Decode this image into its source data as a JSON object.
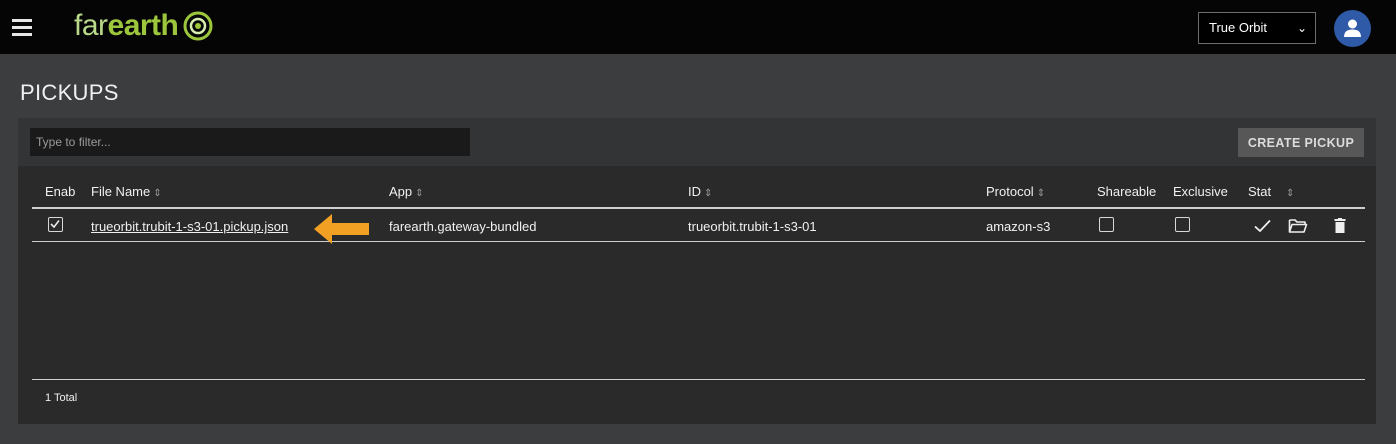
{
  "header": {
    "logo_far": "far",
    "logo_earth": "earth",
    "org_selected": "True Orbit",
    "menu_icon": "hamburger-icon",
    "avatar_icon": "user-icon"
  },
  "page": {
    "title": "PICKUPS"
  },
  "toolbar": {
    "filter_placeholder": "Type to filter...",
    "create_label": "CREATE PICKUP"
  },
  "table": {
    "columns": {
      "enabled": "Enab",
      "file_name": "File Name",
      "app": "App",
      "id": "ID",
      "protocol": "Protocol",
      "shareable": "Shareable",
      "exclusive": "Exclusive",
      "status": "Stat"
    },
    "sort_glyph": "⇕",
    "rows": [
      {
        "enabled": true,
        "file_name": "trueorbit.trubit-1-s3-01.pickup.json",
        "app": "farearth.gateway-bundled",
        "id": "trueorbit.trubit-1-s3-01",
        "protocol": "amazon-s3",
        "shareable": false,
        "exclusive": false,
        "status_icon": "check-icon"
      }
    ],
    "footer_total": "1 Total"
  },
  "colors": {
    "topbar": "#050505",
    "background": "#3b3d3e",
    "card": "#2a2a2a",
    "logo_green": "#9cc63c",
    "avatar": "#2f5aa8",
    "arrow": "#f2a024"
  }
}
